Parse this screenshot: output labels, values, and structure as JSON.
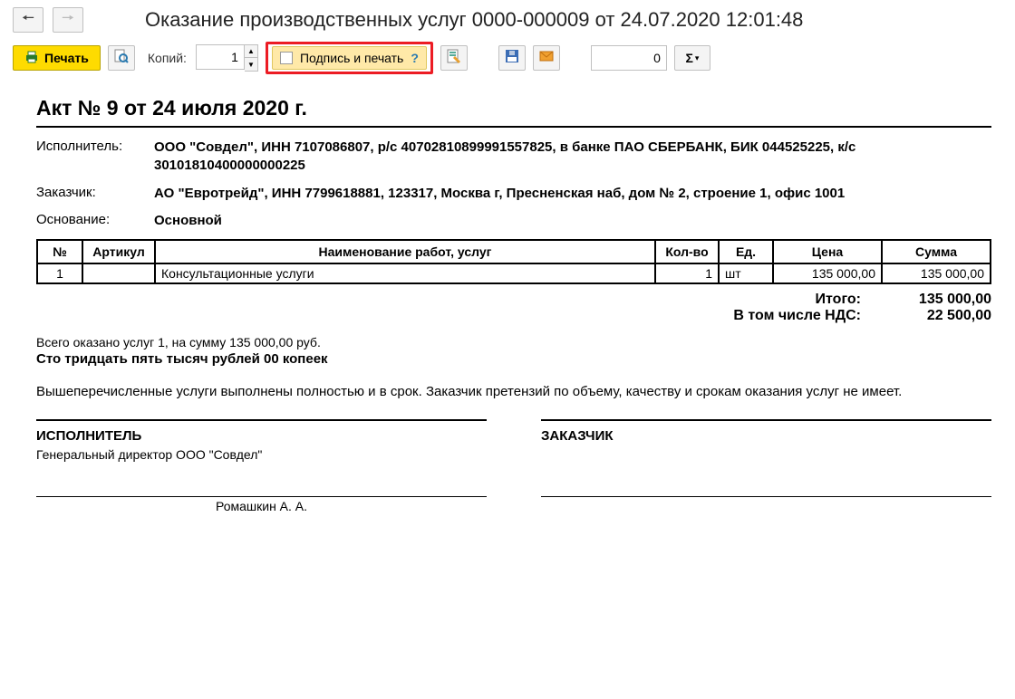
{
  "header": {
    "title": "Оказание производственных услуг 0000-000009 от 24.07.2020 12:01:48"
  },
  "toolbar": {
    "print_label": "Печать",
    "copies_label": "Копий:",
    "copies_value": "1",
    "sign_seal_label": "Подпись и печать",
    "help_char": "?",
    "number_value": "0",
    "sigma_char": "Σ"
  },
  "doc": {
    "title": "Акт № 9 от 24 июля 2020 г.",
    "performer_label": "Исполнитель:",
    "performer_value": "ООО \"Совдел\", ИНН 7107086807, р/с 40702810899991557825, в банке ПАО СБЕРБАНК, БИК 044525225, к/с 30101810400000000225",
    "customer_label": "Заказчик:",
    "customer_value": "АО \"Евротрейд\", ИНН 7799618881, 123317, Москва г, Пресненская наб, дом № 2, строение 1, офис 1001",
    "basis_label": "Основание:",
    "basis_value": "Основной"
  },
  "table": {
    "headers": {
      "num": "№",
      "art": "Артикул",
      "name": "Наименование работ, услуг",
      "qty": "Кол-во",
      "unit": "Ед.",
      "price": "Цена",
      "sum": "Сумма"
    },
    "row": {
      "num": "1",
      "art": "",
      "name": "Консультационные услуги",
      "qty": "1",
      "unit": "шт",
      "price": "135 000,00",
      "sum": "135 000,00"
    }
  },
  "totals": {
    "total_label": "Итого:",
    "total_value": "135 000,00",
    "vat_label": "В том числе НДС:",
    "vat_value": "22 500,00"
  },
  "summary": {
    "line1": "Всего оказано услуг 1, на сумму 135 000,00 руб.",
    "words": "Сто тридцать пять тысяч рублей 00 копеек",
    "disclaimer": "Вышеперечисленные услуги выполнены полностью и в срок. Заказчик претензий по объему, качеству и срокам оказания услуг не имеет."
  },
  "signatures": {
    "performer_header": "ИСПОЛНИТЕЛЬ",
    "performer_sub": "Генеральный директор ООО \"Совдел\"",
    "performer_name": "Ромашкин А. А.",
    "customer_header": "ЗАКАЗЧИК"
  }
}
